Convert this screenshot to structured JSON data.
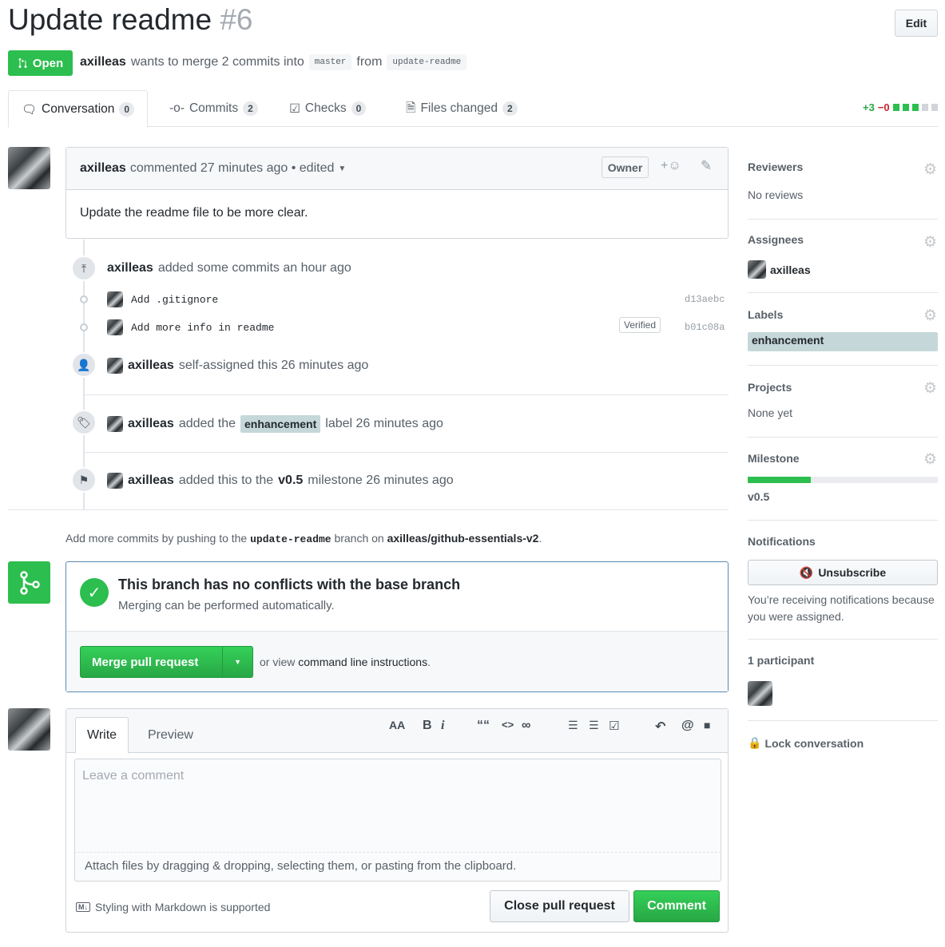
{
  "pr": {
    "title": "Update readme",
    "number": "#6",
    "edit_label": "Edit",
    "state": "Open",
    "author": "axilleas",
    "merge_text": "wants to merge 2 commits into",
    "base_branch": "master",
    "from_text": "from",
    "head_branch": "update-readme"
  },
  "tabs": [
    {
      "label": "Conversation",
      "count": "0"
    },
    {
      "label": "Commits",
      "count": "2"
    },
    {
      "label": "Checks",
      "count": "0"
    },
    {
      "label": "Files changed",
      "count": "2"
    }
  ],
  "diffstat": {
    "added": "+3",
    "removed": "−0"
  },
  "comment": {
    "author": "axilleas",
    "meta": "commented 27 minutes ago • edited",
    "role": "Owner",
    "reaction": "+☺",
    "body": "Update the readme file to be more clear."
  },
  "timeline": {
    "commits_header": {
      "actor": "axilleas",
      "text": "added some commits an hour ago"
    },
    "commits": [
      {
        "message": "Add .gitignore",
        "sha": "d13aebc",
        "verified": ""
      },
      {
        "message": "Add more info in readme",
        "sha": "b01c08a",
        "verified": "Verified"
      }
    ],
    "self_assigned": {
      "actor": "axilleas",
      "text": "self-assigned this 26 minutes ago"
    },
    "label_event": {
      "actor": "axilleas",
      "pre": "added the",
      "label": "enhancement",
      "post": "label 26 minutes ago"
    },
    "milestone_event": {
      "actor": "axilleas",
      "pre": "added this to the",
      "milestone": "v0.5",
      "post": "milestone 26 minutes ago"
    }
  },
  "push_hint": {
    "pre": "Add more commits by pushing to the",
    "branch": "update-readme",
    "mid": "branch on",
    "repo": "axilleas/github-essentials-v2",
    "end": "."
  },
  "merge": {
    "title": "This branch has no conflicts with the base branch",
    "subtitle": "Merging can be performed automatically.",
    "button": "Merge pull request",
    "alt_pre": "or view",
    "alt_link": "command line instructions",
    "alt_end": "."
  },
  "editor": {
    "tab_write": "Write",
    "tab_preview": "Preview",
    "placeholder": "Leave a comment",
    "attach": "Attach files by dragging & dropping, selecting them, or pasting from the clipboard.",
    "markdown_note": "Styling with Markdown is supported",
    "close_button": "Close pull request",
    "comment_button": "Comment",
    "toolbar": {
      "heading": "AA",
      "bold": "B",
      "italic": "i",
      "quote": "““",
      "code": "<>",
      "link": "∞",
      "ul": "☰",
      "ol": "☰",
      "task": "☑",
      "reply": "↶",
      "mention": "@",
      "bookmark": "■"
    }
  },
  "sidebar": {
    "reviewers": {
      "heading": "Reviewers",
      "value": "No reviews"
    },
    "assignees": {
      "heading": "Assignees",
      "value": "axilleas"
    },
    "labels": {
      "heading": "Labels",
      "value": "enhancement"
    },
    "projects": {
      "heading": "Projects",
      "value": "None yet"
    },
    "milestone": {
      "heading": "Milestone",
      "value": "v0.5",
      "progress": 0.33
    },
    "notifications": {
      "heading": "Notifications",
      "button": "Unsubscribe",
      "reason": "You’re receiving notifications because you were assigned."
    },
    "participants": {
      "heading": "1 participant"
    },
    "lock": "Lock conversation"
  },
  "colors": {
    "green": "#2cbe4e",
    "label": "#c5d7d9",
    "gray_text": "#586069"
  }
}
